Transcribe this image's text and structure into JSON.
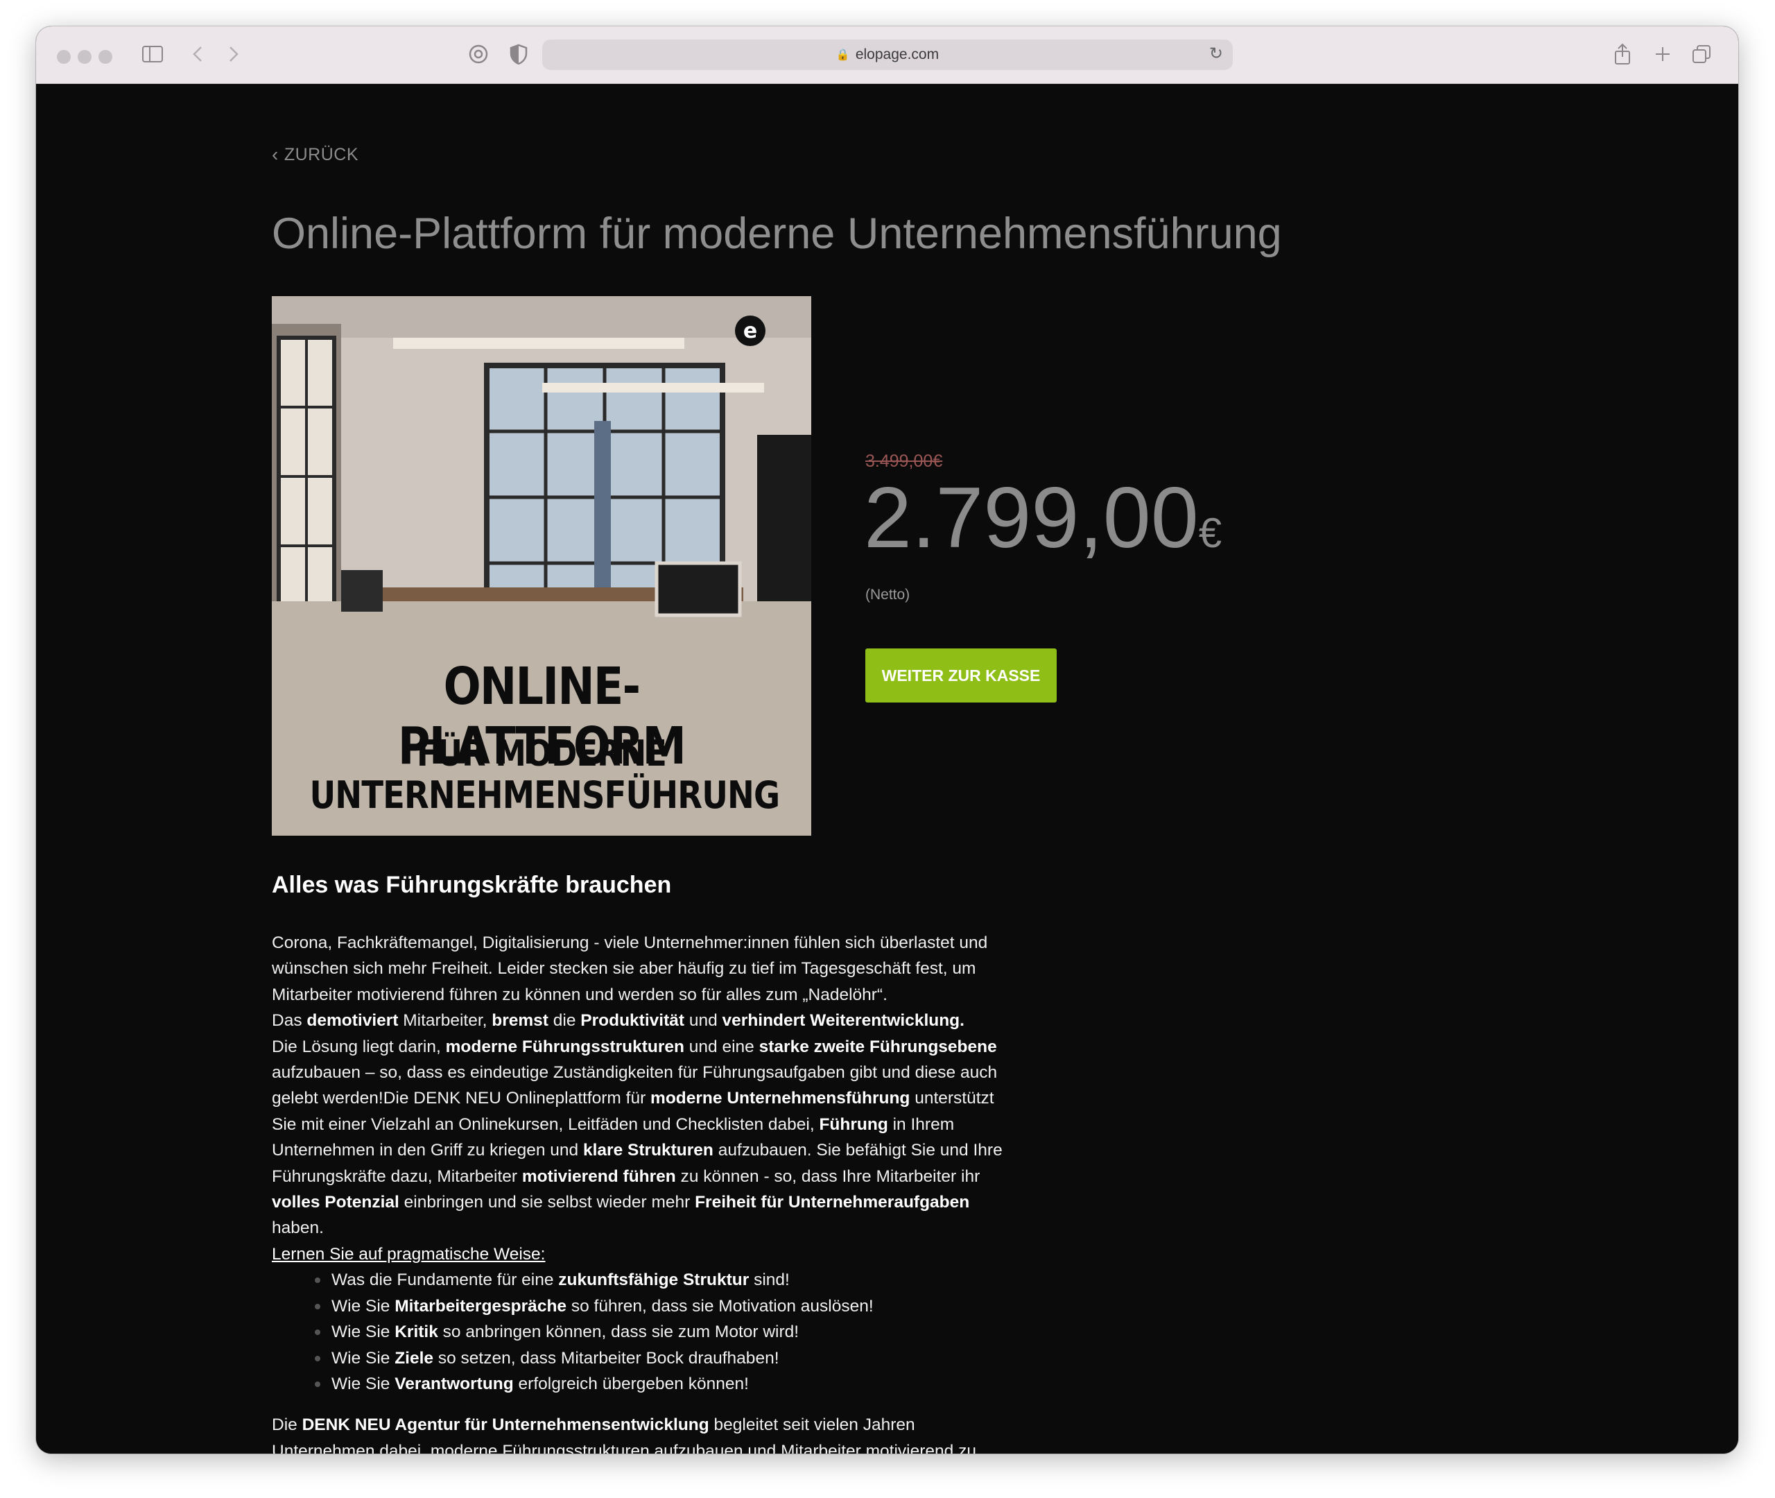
{
  "browser": {
    "url": "elopage.com"
  },
  "page": {
    "back_label": "ZURÜCK",
    "title": "Online-Plattform für moderne Unternehmensführung",
    "image_text": {
      "line1": "ONLINE-PLATTFORM",
      "line2": "FÜR MODERNE",
      "line3": "UNTERNEHMENSFÜHRUNG"
    },
    "old_price": "3.499,00€",
    "price": "2.799,00",
    "currency": "€",
    "price_note": "(Netto)",
    "checkout_label": "WEITER ZUR KASSE",
    "section_title": "Alles was Führungskräfte brauchen",
    "desc": {
      "p1": "Corona, Fachkräftemangel, Digitalisierung - viele Unternehmer:innen fühlen sich überlastet und wünschen sich mehr Freiheit. Leider stecken sie aber häufig zu tief im Tagesgeschäft fest, um Mitarbeiter motivierend führen zu können und werden so für alles zum „Nadelöhr“.",
      "s1": "Das ",
      "b1": "demotiviert",
      "s2": " Mitarbeiter, ",
      "b2": "bremst",
      "s3": " die ",
      "b3": "Produktivität",
      "s4": " und ",
      "b4": "verhindert Weiterentwicklung.",
      "s5": "Die Lösung liegt darin, ",
      "b5": "moderne Führungsstrukturen",
      "s6": " und eine ",
      "b6": "starke zweite Führungsebene",
      "s7": " aufzubauen – so, dass es eindeutige Zuständigkeiten für Führungsaufgaben gibt und diese auch gelebt werden!Die DENK NEU Onlineplattform für ",
      "b7": "moderne Unternehmensführung",
      "s8": " unterstützt Sie mit einer Vielzahl an Onlinekursen, Leitfäden und Checklisten dabei, ",
      "b8": "Führung",
      "s9": " in Ihrem Unternehmen in den Griff zu kriegen und ",
      "b9": "klare Strukturen",
      "s10": " aufzubauen. Sie befähigt Sie und Ihre Führungskräfte dazu, Mitarbeiter ",
      "b10": "motivierend führen",
      "s11": " zu können - so, dass Ihre Mitarbeiter ihr ",
      "b11": "volles Potenzial",
      "s12": " einbringen und sie selbst wieder mehr ",
      "b12": "Freiheit für Unternehmeraufgaben",
      "s13": " haben.",
      "learn_link": "Lernen Sie auf pragmatische Weise: ",
      "bullets": [
        {
          "pre": "Was die Fundamente für eine ",
          "bold": "zukunftsfähige Struktur",
          "post": " sind!"
        },
        {
          "pre": "Wie Sie ",
          "bold": "Mitarbeitergespräche",
          "post": " so führen, dass sie Motivation auslösen!"
        },
        {
          "pre": "Wie Sie ",
          "bold": "Kritik",
          "post": " so anbringen können, dass sie zum Motor wird!"
        },
        {
          "pre": "Wie Sie ",
          "bold": "Ziele",
          "post": " so setzen, dass Mitarbeiter Bock draufhaben!"
        },
        {
          "pre": "Wie Sie ",
          "bold": "Verantwortung",
          "post": " erfolgreich übergeben können!"
        }
      ],
      "p2_pre": "Die ",
      "p2_bold": "DENK NEU Agentur für Unternehmensentwicklung",
      "p2_post": " begleitet seit vielen Jahren Unternehmen dabei, moderne Führungsstrukturen aufzubauen und Mitarbeiter motivierend zu"
    }
  },
  "colors": {
    "page_bg": "#0b0b0b",
    "title": "#8e8e8e",
    "cta": "#8fbf16",
    "old_price": "#9a5555"
  }
}
